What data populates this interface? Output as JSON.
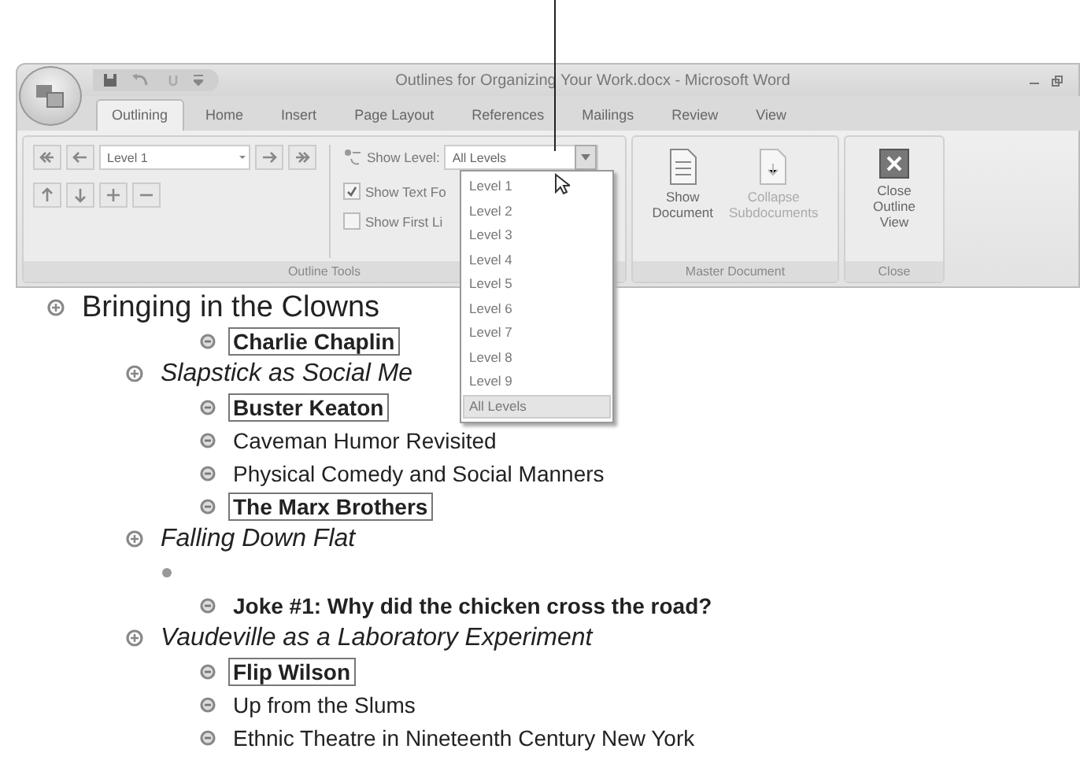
{
  "window": {
    "title": "Outlines for Organizing Your Work.docx - Microsoft Word"
  },
  "tabs": [
    {
      "label": "Outlining",
      "selected": true
    },
    {
      "label": "Home",
      "selected": false
    },
    {
      "label": "Insert",
      "selected": false
    },
    {
      "label": "Page Layout",
      "selected": false
    },
    {
      "label": "References",
      "selected": false
    },
    {
      "label": "Mailings",
      "selected": false
    },
    {
      "label": "Review",
      "selected": false
    },
    {
      "label": "View",
      "selected": false
    }
  ],
  "outline_tools": {
    "level_select": "Level 1",
    "show_level_label": "Show Level:",
    "show_level_value": "All Levels",
    "checkboxes": [
      {
        "label": "Show Text Fo",
        "checked": true
      },
      {
        "label": "Show First Li",
        "checked": false
      }
    ],
    "group_label": "Outline Tools"
  },
  "master_document": {
    "buttons": [
      {
        "lines": [
          "Show",
          "Document"
        ],
        "disabled": false
      },
      {
        "lines": [
          "Collapse",
          "Subdocuments"
        ],
        "disabled": true
      }
    ],
    "group_label": "Master Document"
  },
  "close": {
    "lines": [
      "Close",
      "Outline View"
    ],
    "group_label": "Close"
  },
  "show_level_menu": [
    {
      "label": "Level 1",
      "selected": false
    },
    {
      "label": "Level 2",
      "selected": false
    },
    {
      "label": "Level 3",
      "selected": false
    },
    {
      "label": "Level 4",
      "selected": false
    },
    {
      "label": "Level 5",
      "selected": false
    },
    {
      "label": "Level 6",
      "selected": false
    },
    {
      "label": "Level 7",
      "selected": false
    },
    {
      "label": "Level 8",
      "selected": false
    },
    {
      "label": "Level 9",
      "selected": false
    },
    {
      "label": "All Levels",
      "selected": true
    }
  ],
  "outline": [
    {
      "kind": "heading1",
      "text": "Bringing in the Clowns",
      "children": [
        {
          "kind": "body",
          "text": "Charlie Chaplin",
          "bold": true,
          "framed": true
        },
        {
          "kind": "heading2",
          "text": "Slapstick as Social Me",
          "children": [
            {
              "kind": "body",
              "text": "Buster Keaton",
              "bold": true,
              "framed": true
            },
            {
              "kind": "body",
              "text": "Caveman Humor Revisited",
              "bold": false,
              "framed": false
            },
            {
              "kind": "body",
              "text": "Physical Comedy and Social Manners",
              "bold": false,
              "framed": false
            },
            {
              "kind": "body",
              "text": "The Marx Brothers",
              "bold": true,
              "framed": true
            }
          ]
        },
        {
          "kind": "heading2",
          "text": "Falling Down Flat",
          "children": [
            {
              "kind": "empty"
            },
            {
              "kind": "body",
              "text": "Joke #1: Why did the chicken cross the road?",
              "bold": true,
              "framed": false
            }
          ]
        },
        {
          "kind": "heading2",
          "text": "Vaudeville as a Laboratory Experiment",
          "children": [
            {
              "kind": "body",
              "text": "Flip Wilson",
              "bold": true,
              "framed": true
            },
            {
              "kind": "body",
              "text": "Up from the Slums",
              "bold": false,
              "framed": false
            },
            {
              "kind": "body",
              "text": "Ethnic Theatre in Nineteenth Century New York",
              "bold": false,
              "framed": false
            }
          ]
        }
      ]
    }
  ]
}
